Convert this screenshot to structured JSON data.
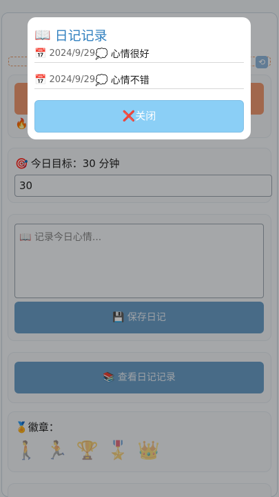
{
  "goal": {
    "label": "今日目标：30 分钟",
    "input_value": "30"
  },
  "journal": {
    "placeholder": "📖 记录今日心情...",
    "save_label": "💾 保存日记",
    "view_label": "📚 查看日记记录"
  },
  "badges": {
    "title": "徽章：",
    "items": [
      "🚶",
      "🏃",
      "🏆",
      "🎖️",
      "👑"
    ]
  },
  "modal": {
    "title": "日记记录",
    "entries": [
      {
        "date": "2024/9/29",
        "text": "心情很好"
      },
      {
        "date": "2024/9/29",
        "text": "心情不错"
      }
    ],
    "close_label": "关闭"
  },
  "colors": {
    "accent_orange": "#ee9970",
    "primary_blue": "#6a9ec8",
    "modal_button": "#8bcff6",
    "modal_title": "#2f7fbf"
  }
}
